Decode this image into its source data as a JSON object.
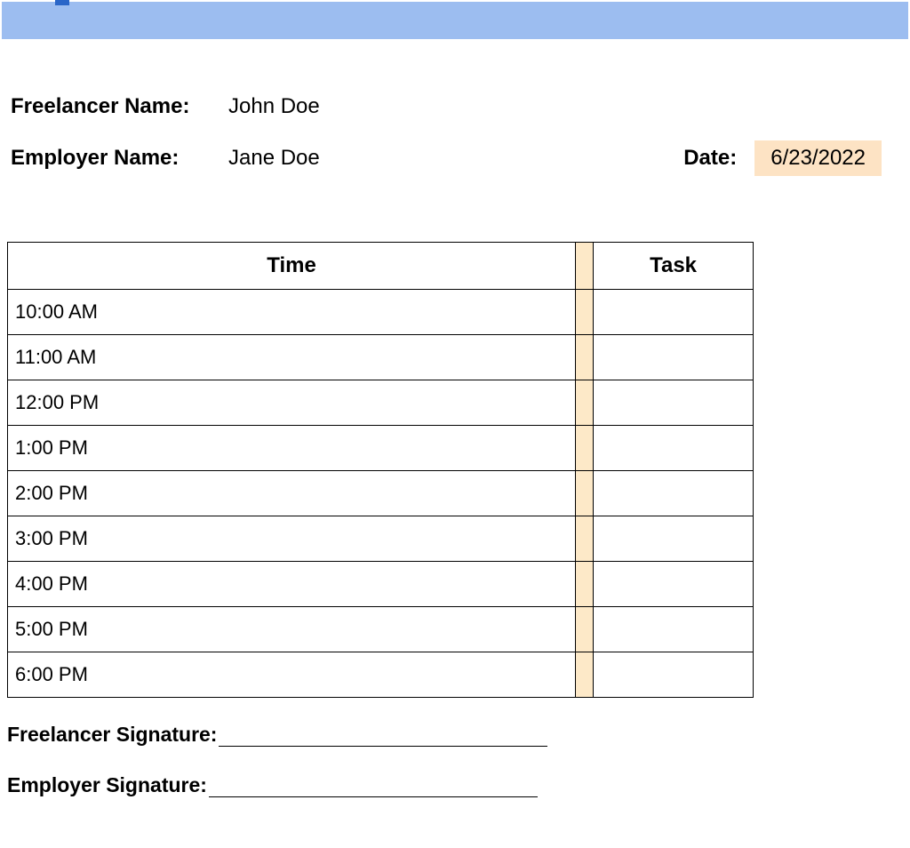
{
  "header": {
    "freelancer_label": "Freelancer Name:",
    "freelancer_value": "John Doe",
    "employer_label": "Employer Name:",
    "employer_value": "Jane Doe",
    "date_label": "Date:",
    "date_value": "6/23/2022"
  },
  "table": {
    "time_header": "Time",
    "task_header": "Task",
    "rows": [
      {
        "time": "10:00 AM",
        "task": ""
      },
      {
        "time": "11:00 AM",
        "task": ""
      },
      {
        "time": "12:00 PM",
        "task": ""
      },
      {
        "time": "1:00 PM",
        "task": ""
      },
      {
        "time": "2:00 PM",
        "task": ""
      },
      {
        "time": "3:00 PM",
        "task": ""
      },
      {
        "time": "4:00 PM",
        "task": ""
      },
      {
        "time": "5:00 PM",
        "task": ""
      },
      {
        "time": "6:00 PM",
        "task": ""
      }
    ]
  },
  "signatures": {
    "freelancer_label": "Freelancer Signature:",
    "employer_label": "Employer Signature:"
  }
}
